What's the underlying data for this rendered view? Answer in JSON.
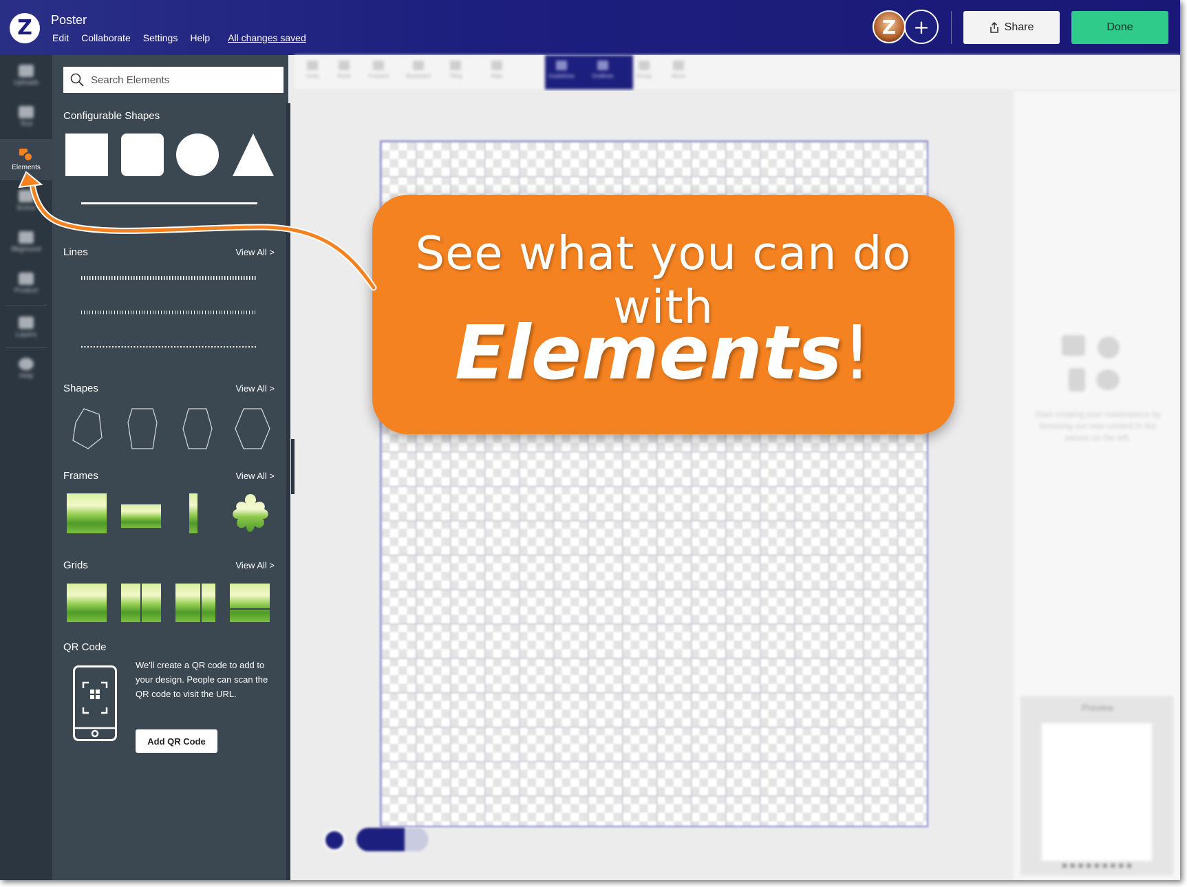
{
  "header": {
    "logo_letter": "Z",
    "doc_title": "Poster",
    "menu": [
      "Edit",
      "Collaborate",
      "Settings",
      "Help"
    ],
    "save_status": "All changes saved",
    "share_label": "Share",
    "done_label": "Done",
    "add_symbol": "+"
  },
  "rail": {
    "items": [
      {
        "label": "Uploads",
        "icon": "upload-icon"
      },
      {
        "label": "Text",
        "icon": "text-icon"
      },
      {
        "label": "Elements",
        "icon": "elements-icon"
      },
      {
        "label": "Scene",
        "icon": "scene-icon"
      },
      {
        "label": "Bkground",
        "icon": "background-icon"
      },
      {
        "label": "Product",
        "icon": "product-icon"
      },
      {
        "label": "Layers",
        "icon": "layers-icon"
      },
      {
        "label": "Help",
        "icon": "help-icon"
      }
    ]
  },
  "panel": {
    "search_placeholder": "Search Elements",
    "configurable_title": "Configurable Shapes",
    "lines_title": "Lines",
    "shapes_title": "Shapes",
    "frames_title": "Frames",
    "grids_title": "Grids",
    "view_all": "View All >",
    "qr": {
      "title": "QR Code",
      "text": "We'll create a QR code to add to your design. People can scan the QR code to visit the URL.",
      "button": "Add QR Code"
    }
  },
  "toolbar": {
    "items": [
      "Undo",
      "Redo",
      "Forward",
      "Backward",
      "Tiling",
      "Align",
      "Guidelines",
      "Gridlines",
      "Group",
      "Move"
    ]
  },
  "right_panel": {
    "empty_text": "Start creating your masterpiece by browsing our new content in the panels on the left.",
    "preview_title": "Preview"
  },
  "callout": {
    "line1": "See what you can do with",
    "word": "Elements",
    "punct": "!"
  },
  "colors": {
    "header_bg": "#1d1f7e",
    "panel_bg": "#3b4751",
    "rail_bg": "#2c3640",
    "accent_orange": "#f58220",
    "done_green": "#2ecb8b"
  }
}
